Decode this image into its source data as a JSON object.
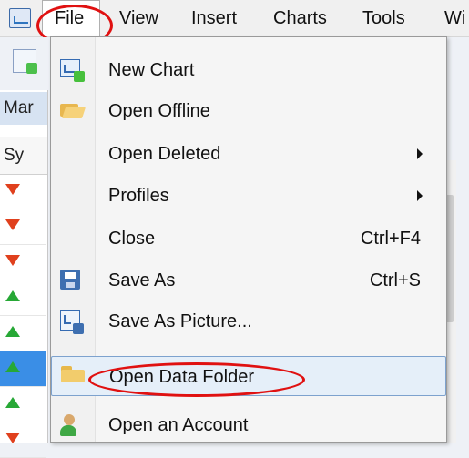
{
  "menubar": {
    "items": [
      {
        "label": "File"
      },
      {
        "label": "View"
      },
      {
        "label": "Insert"
      },
      {
        "label": "Charts"
      },
      {
        "label": "Tools"
      },
      {
        "label": "Wi"
      }
    ]
  },
  "market_watch": {
    "tab_label": "Mar",
    "column_header": "Sy",
    "row_trends": [
      "down",
      "down",
      "down",
      "up",
      "up",
      "up",
      "up",
      "down"
    ],
    "selected_row": 5
  },
  "file_menu": {
    "items": [
      {
        "label": "New Chart",
        "icon": "new-chart-icon"
      },
      {
        "label": "Open Offline",
        "icon": "folder-open-icon"
      },
      {
        "label": "Open Deleted",
        "submenu": true
      },
      {
        "label": "Profiles",
        "submenu": true
      },
      {
        "label": "Close",
        "shortcut": "Ctrl+F4"
      },
      {
        "label": "Save As",
        "shortcut": "Ctrl+S",
        "icon": "save-icon"
      },
      {
        "label": "Save As Picture...",
        "icon": "save-picture-icon"
      },
      {
        "label": "Open Data Folder",
        "icon": "folder-icon",
        "highlighted": true
      },
      {
        "label": "Open an Account",
        "icon": "account-icon"
      }
    ]
  },
  "colors": {
    "annotation": "#e01111",
    "highlight": "#e5eff9",
    "up_arrow": "#27a836",
    "down_arrow": "#e0401d"
  }
}
